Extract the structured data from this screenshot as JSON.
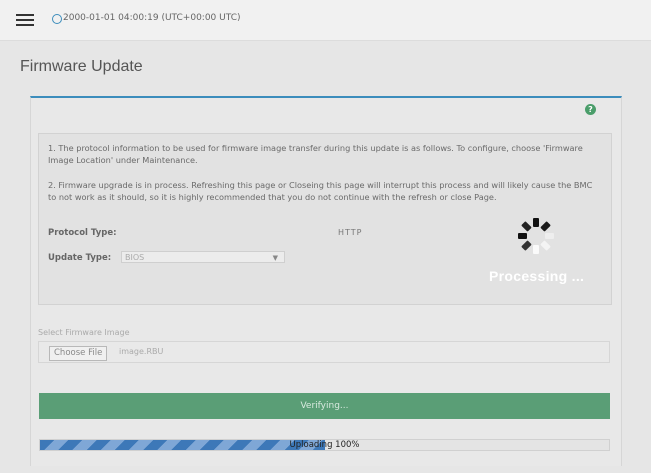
{
  "header": {
    "menu_icon": "hamburger-icon",
    "clock_icon": "clock-icon",
    "datetime": "2000-01-01 04:00:19 (UTC+00:00 UTC)"
  },
  "page": {
    "title": "Firmware Update"
  },
  "panel": {
    "help_icon": "question-circle-icon",
    "help_glyph": "?",
    "note1": "1. The protocol information to be used for firmware image transfer during this update is as follows. To configure, choose 'Firmware Image Location' under Maintenance.",
    "note2": "2. Firmware upgrade is in process. Refreshing this page or Closeing this page will interrupt this process and will likely cause the BMC to not work as it should, so it is highly recommended that you do not continue with the refresh or close Page.",
    "protocol_label": "Protocol Type:",
    "protocol_value": "HTTP",
    "update_type_label": "Update Type:",
    "update_type_value": "BIOS",
    "select_arrow": "▼"
  },
  "overlay": {
    "spinner_icon": "loading-spinner-icon",
    "processing_text": "Processing ..."
  },
  "file_select": {
    "label": "Select Firmware Image",
    "button_label": "Choose File",
    "file_name": "image.RBU"
  },
  "actions": {
    "verify_label": "Verifying..."
  },
  "progress": {
    "value": 100,
    "display_fill_fraction": 0.5,
    "text": "Uploading 100%"
  },
  "colors": {
    "accent": "#3c8dbc",
    "verify_button": "#5a9e76",
    "help_icon": "#4a9d6a",
    "progress_stripe_dark": "#3d78b8",
    "progress_stripe_light": "#7fa7d6"
  }
}
